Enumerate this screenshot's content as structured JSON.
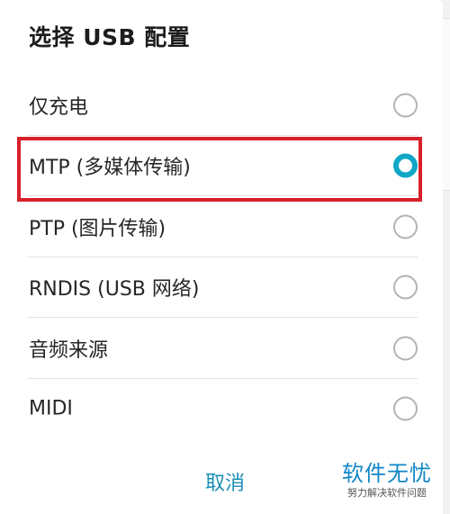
{
  "dialog": {
    "title": "选择 USB 配置",
    "options": [
      {
        "label": "仅充电",
        "selected": false
      },
      {
        "label": "MTP (多媒体传输)",
        "selected": true
      },
      {
        "label": "PTP (图片传输)",
        "selected": false
      },
      {
        "label": "RNDIS (USB 网络)",
        "selected": false
      },
      {
        "label": "音频来源",
        "selected": false
      },
      {
        "label": "MIDI",
        "selected": false
      }
    ],
    "cancel_label": "取消"
  },
  "watermark": {
    "main": "软件无忧",
    "sub": "努力解决软件问题"
  },
  "colors": {
    "accent": "#10a7c7",
    "highlight_border": "#d8202a",
    "cancel_text": "#1a8fb5"
  }
}
